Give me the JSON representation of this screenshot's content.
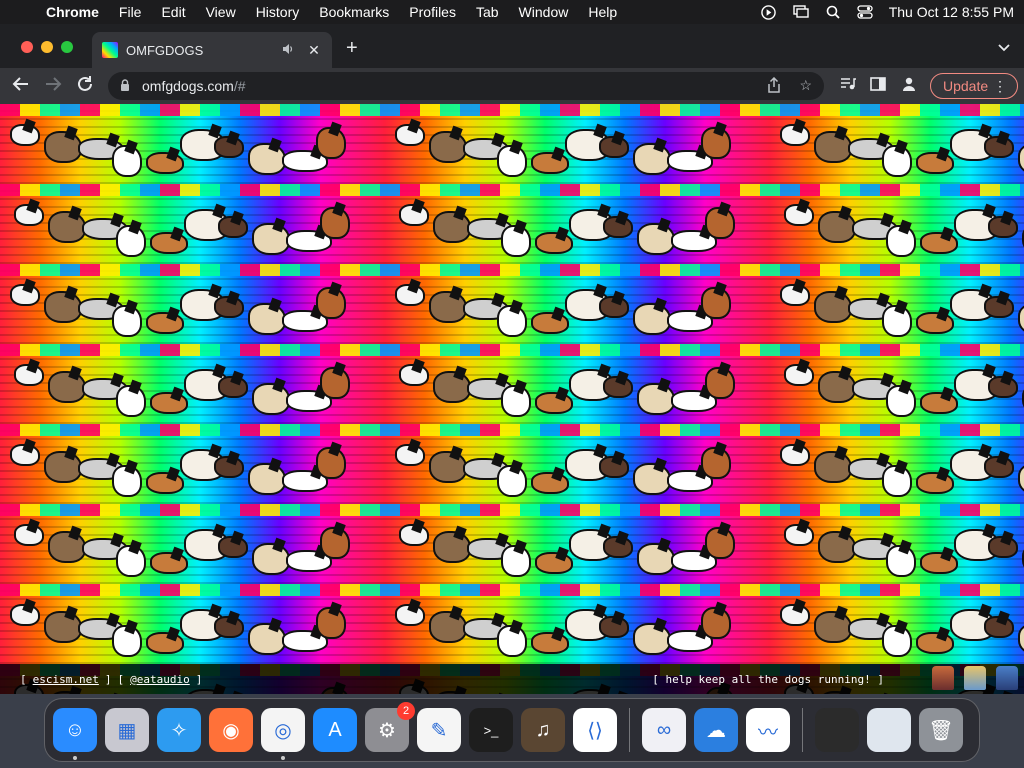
{
  "menubar": {
    "app_name": "Chrome",
    "items": [
      "File",
      "Edit",
      "View",
      "History",
      "Bookmarks",
      "Profiles",
      "Tab",
      "Window",
      "Help"
    ],
    "clock": "Thu Oct 12  8:55 PM",
    "status_icons": [
      "play-circle-icon",
      "screen-mirror-icon",
      "search-icon",
      "control-center-icon"
    ]
  },
  "tab": {
    "title": "OMFGDOGS"
  },
  "toolbar": {
    "url_host": "omfgdogs.com",
    "url_path": "/#",
    "update_label": "Update"
  },
  "footer": {
    "bracket_open": "[",
    "bracket_close": "]",
    "link1": "escism.net",
    "link2": "@eataudio",
    "tagline": "[ help keep all the dogs running! ]"
  },
  "dock": {
    "apps": [
      {
        "name": "Finder",
        "icon": "finder-icon",
        "color": "#2a8cff"
      },
      {
        "name": "Launchpad",
        "icon": "launchpad-icon",
        "color": "#c8c8d0"
      },
      {
        "name": "Safari",
        "icon": "safari-icon",
        "color": "#2d9bf0"
      },
      {
        "name": "Firefox",
        "icon": "firefox-icon",
        "color": "#ff7139"
      },
      {
        "name": "Chrome",
        "icon": "chrome-icon",
        "color": "#f4f4f4"
      },
      {
        "name": "App Store",
        "icon": "app-store-icon",
        "color": "#1e8cff"
      },
      {
        "name": "System Settings",
        "icon": "settings-icon",
        "color": "#8e8e93",
        "badge": "2"
      },
      {
        "name": "TextEdit",
        "icon": "textedit-icon",
        "color": "#f5f5f5"
      },
      {
        "name": "Terminal",
        "icon": "terminal-icon",
        "color": "#1e1e1e"
      },
      {
        "name": "GarageBand",
        "icon": "garageband-icon",
        "color": "#5a4632"
      },
      {
        "name": "VS Code",
        "icon": "vscode-icon",
        "color": "#ffffff"
      },
      {
        "name": "Visual Studio",
        "icon": "visual-studio-icon",
        "color": "#f0f0f5"
      },
      {
        "name": "Weather",
        "icon": "weather-icon",
        "color": "#2b7fe0"
      },
      {
        "name": "Freeform",
        "icon": "freeform-icon",
        "color": "#ffffff"
      }
    ]
  }
}
